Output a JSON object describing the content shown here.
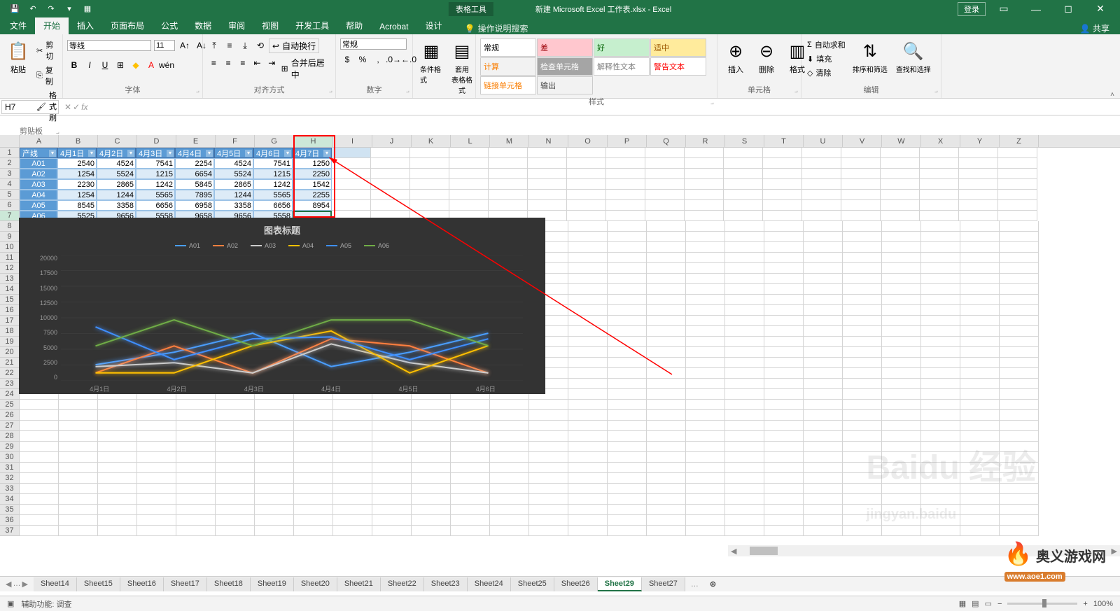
{
  "title_bar": {
    "tools_tab": "表格工具",
    "doc_title": "新建 Microsoft Excel 工作表.xlsx - Excel",
    "login": "登录",
    "share": "共享"
  },
  "ribbon_tabs": [
    "文件",
    "开始",
    "插入",
    "页面布局",
    "公式",
    "数据",
    "审阅",
    "视图",
    "开发工具",
    "帮助",
    "Acrobat",
    "设计"
  ],
  "active_tab": "开始",
  "tell_me": "操作说明搜索",
  "ribbon": {
    "clipboard": {
      "label": "剪贴板",
      "paste": "粘贴",
      "cut": "剪切",
      "copy": "复制",
      "format_painter": "格式刷"
    },
    "font": {
      "label": "字体",
      "name": "等线",
      "size": "11"
    },
    "alignment": {
      "label": "对齐方式",
      "wrap": "自动换行",
      "merge": "合并后居中"
    },
    "number": {
      "label": "数字",
      "format": "常规"
    },
    "styles_group": {
      "label": "样式",
      "conditional": "条件格式",
      "table": "套用\n表格格式",
      "cell_styles": "单元格样式"
    },
    "styles": [
      {
        "label": "常规",
        "bg": "#ffffff",
        "color": "#000"
      },
      {
        "label": "差",
        "bg": "#ffc7ce",
        "color": "#9c0006"
      },
      {
        "label": "好",
        "bg": "#c6efce",
        "color": "#006100"
      },
      {
        "label": "适中",
        "bg": "#ffeb9c",
        "color": "#9c5700"
      },
      {
        "label": "计算",
        "bg": "#f2f2f2",
        "color": "#fa7d00"
      },
      {
        "label": "检查单元格",
        "bg": "#a5a5a5",
        "color": "#fff"
      },
      {
        "label": "解释性文本",
        "bg": "#fff",
        "color": "#7f7f7f"
      },
      {
        "label": "警告文本",
        "bg": "#fff",
        "color": "#ff0000"
      },
      {
        "label": "链接单元格",
        "bg": "#fff",
        "color": "#fa7d00"
      },
      {
        "label": "输出",
        "bg": "#f2f2f2",
        "color": "#3f3f3f"
      }
    ],
    "cells": {
      "label": "单元格",
      "insert": "插入",
      "delete": "删除",
      "format": "格式"
    },
    "editing": {
      "label": "编辑",
      "autosum": "自动求和",
      "fill": "填充",
      "clear": "清除",
      "sort": "排序和筛选",
      "find": "查找和选择"
    }
  },
  "name_box": "H7",
  "columns": [
    "A",
    "B",
    "C",
    "D",
    "E",
    "F",
    "G",
    "H",
    "I",
    "J",
    "K",
    "L",
    "M",
    "N",
    "O",
    "P",
    "Q",
    "R",
    "S",
    "T",
    "U",
    "V",
    "W",
    "X",
    "Y",
    "Z"
  ],
  "col_widths": {
    "A": 54,
    "default": 56,
    "narrow": 56
  },
  "table": {
    "headers": [
      "产线",
      "4月1日",
      "4月2日",
      "4月3日",
      "4月4日",
      "4月5日",
      "4月6日",
      "4月7日"
    ],
    "rows": [
      [
        "A01",
        2540,
        4524,
        7541,
        2254,
        4524,
        7541,
        1250
      ],
      [
        "A02",
        1254,
        5524,
        1215,
        6654,
        5524,
        1215,
        2250
      ],
      [
        "A03",
        2230,
        2865,
        1242,
        5845,
        2865,
        1242,
        1542
      ],
      [
        "A04",
        1254,
        1244,
        5565,
        7895,
        1244,
        5565,
        2255
      ],
      [
        "A05",
        8545,
        3358,
        6656,
        6958,
        3358,
        6656,
        8954
      ],
      [
        "A06",
        5525,
        9656,
        5558,
        9658,
        9656,
        5558,
        ""
      ]
    ]
  },
  "chart_data": {
    "type": "line",
    "title": "图表标题",
    "categories": [
      "4月1日",
      "4月2日",
      "4月3日",
      "4月4日",
      "4月5日",
      "4月6日"
    ],
    "ylim": [
      0,
      20000
    ],
    "yticks": [
      0,
      2500,
      5000,
      7500,
      10000,
      12500,
      15000,
      17500,
      20000
    ],
    "series": [
      {
        "name": "A01",
        "color": "#4a9eff",
        "values": [
          2540,
          4524,
          7541,
          2254,
          4524,
          7541
        ]
      },
      {
        "name": "A02",
        "color": "#ff7f3f",
        "values": [
          1254,
          5524,
          1215,
          6654,
          5524,
          1215
        ]
      },
      {
        "name": "A03",
        "color": "#cccccc",
        "values": [
          2230,
          2865,
          1242,
          5845,
          2865,
          1242
        ]
      },
      {
        "name": "A04",
        "color": "#ffc000",
        "values": [
          1254,
          1244,
          5565,
          7895,
          1244,
          5565
        ]
      },
      {
        "name": "A05",
        "color": "#3f8fff",
        "values": [
          8545,
          3358,
          6656,
          6958,
          3358,
          6656
        ]
      },
      {
        "name": "A06",
        "color": "#70ad47",
        "values": [
          5525,
          9656,
          5558,
          9658,
          9656,
          5558
        ]
      }
    ]
  },
  "sheets": [
    "Sheet14",
    "Sheet15",
    "Sheet16",
    "Sheet17",
    "Sheet18",
    "Sheet19",
    "Sheet20",
    "Sheet21",
    "Sheet22",
    "Sheet23",
    "Sheet24",
    "Sheet25",
    "Sheet26",
    "Sheet29",
    "Sheet27"
  ],
  "active_sheet": "Sheet29",
  "status": {
    "ready": "辅助功能: 调查",
    "zoom": "100%"
  },
  "watermark_site": "奥义游戏网",
  "watermark_url": "www.aoe1.com"
}
